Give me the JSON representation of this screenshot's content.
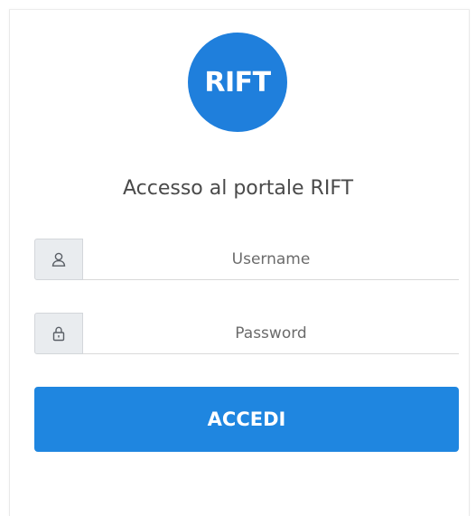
{
  "logo": {
    "text": "RIFT",
    "color": "#1f7fdc"
  },
  "title": "Accesso al portale RIFT",
  "form": {
    "username": {
      "placeholder": "Username",
      "value": "",
      "icon": "user-icon"
    },
    "password": {
      "placeholder": "Password",
      "value": "",
      "icon": "lock-icon"
    },
    "submit_label": "ACCEDI",
    "submit_color": "#1f86e0"
  }
}
